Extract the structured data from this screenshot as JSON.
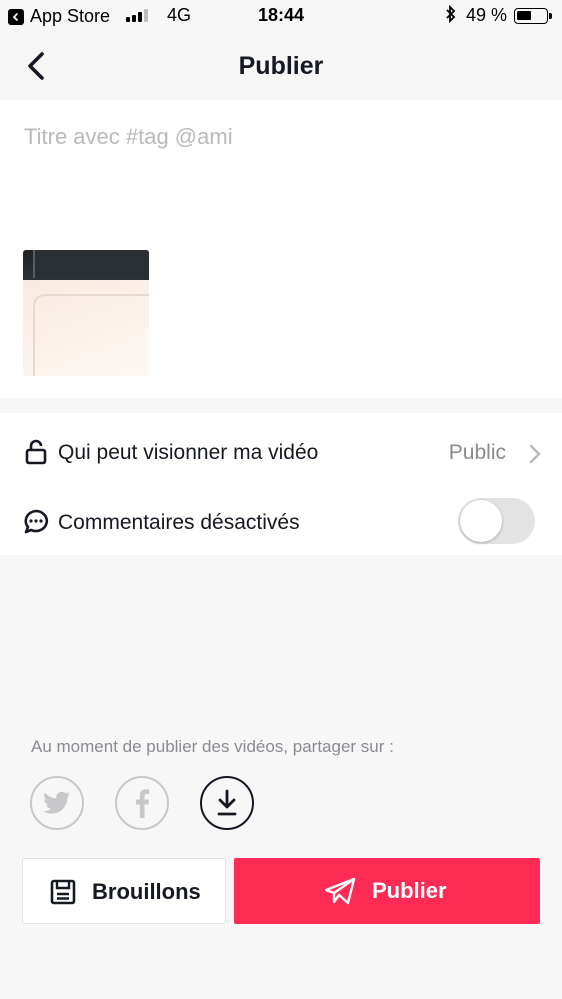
{
  "status_bar": {
    "back_app": "App Store",
    "network": "4G",
    "time": "18:44",
    "battery": "49 %",
    "battery_level": 0.49
  },
  "header": {
    "title": "Publier"
  },
  "caption": {
    "placeholder": "Titre avec #tag @ami",
    "value": ""
  },
  "settings": {
    "privacy_label": "Qui peut visionner ma vidéo",
    "privacy_value": "Public",
    "comments_label": "Commentaires désactivés",
    "comments_enabled": false
  },
  "share": {
    "label": "Au moment de publier des vidéos, partager sur :",
    "targets": [
      "twitter-icon",
      "facebook-icon",
      "download-icon"
    ]
  },
  "actions": {
    "drafts_label": "Brouillons",
    "publish_label": "Publier"
  },
  "colors": {
    "accent": "#fe2c55",
    "background": "#f7f7f7",
    "card": "#ffffff",
    "muted_text": "#8a8b91",
    "icon_inactive": "#c8c8cb"
  }
}
